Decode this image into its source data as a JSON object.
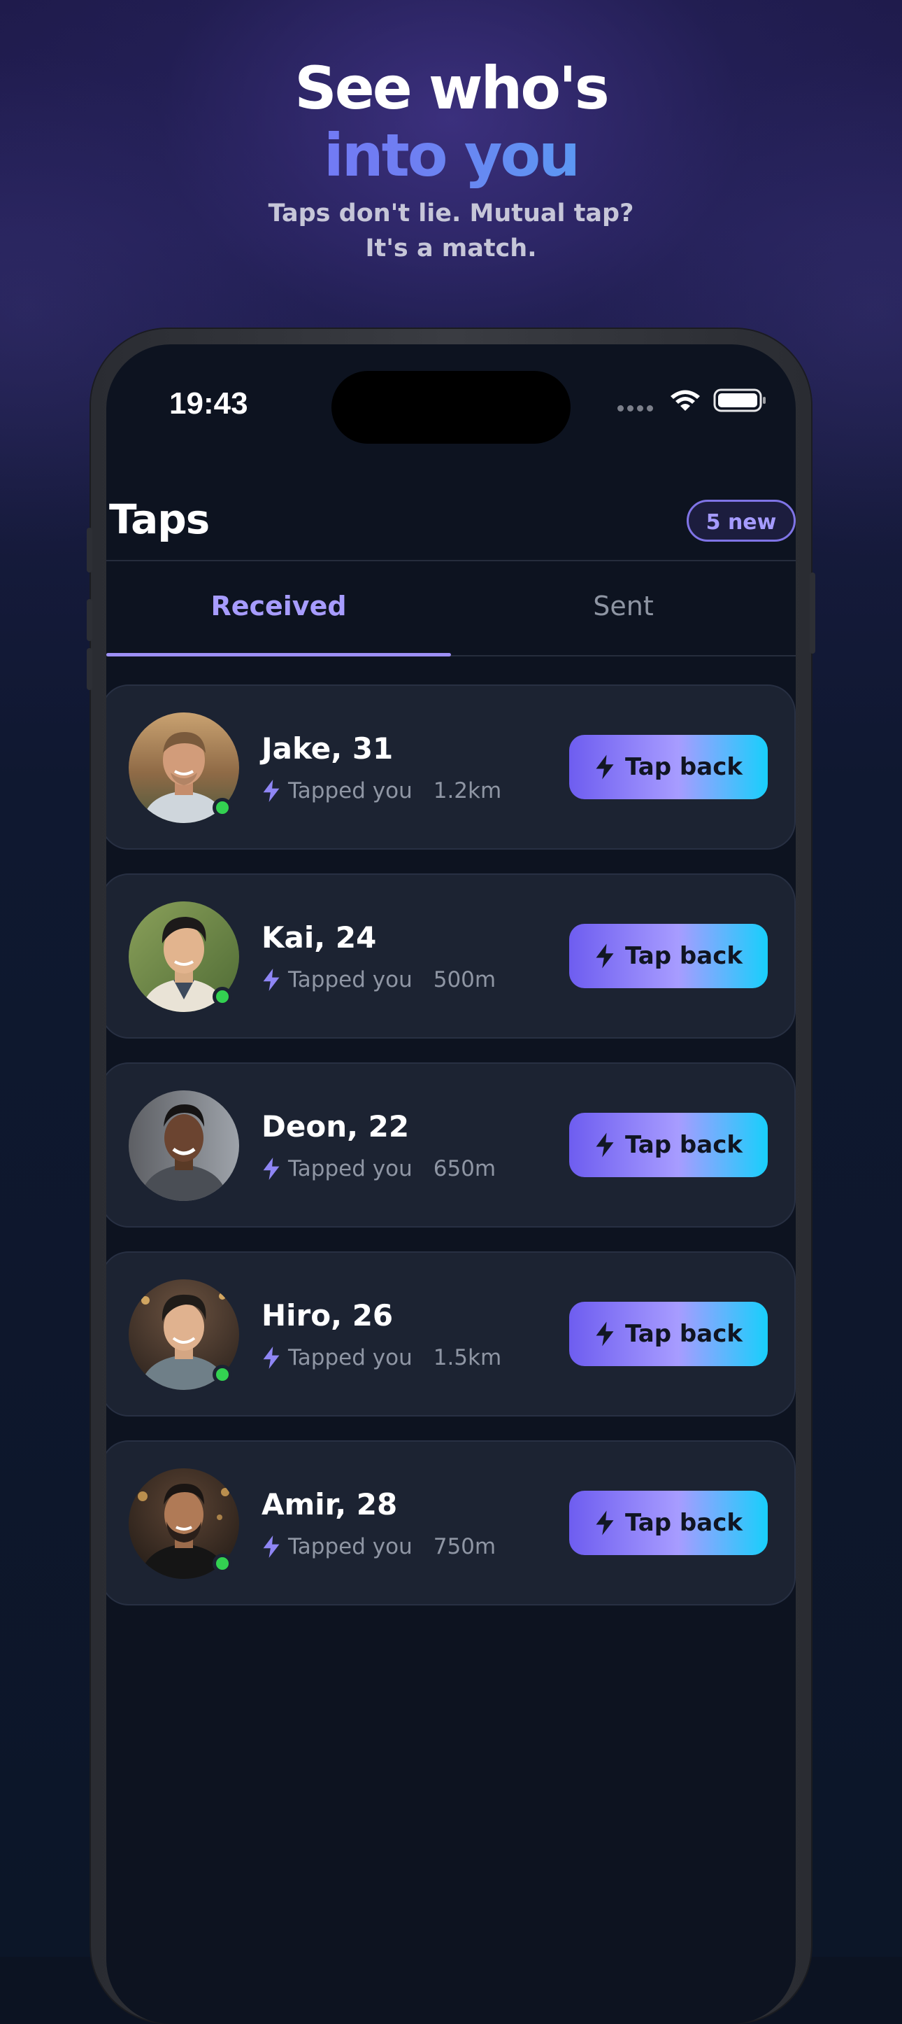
{
  "hero": {
    "line1": "See who's",
    "line2": "into you",
    "subtitle_line1": "Taps don't lie. Mutual tap?",
    "subtitle_line2": "It's a match."
  },
  "status_bar": {
    "time": "19:43"
  },
  "header": {
    "title": "Taps",
    "badge": "5 new"
  },
  "tabs": {
    "received": "Received",
    "sent": "Sent",
    "active": "Received"
  },
  "taps": [
    {
      "name": "Jake, 31",
      "status": "Tapped you",
      "distance": "1.2km",
      "online": true,
      "button": "Tap back"
    },
    {
      "name": "Kai, 24",
      "status": "Tapped you",
      "distance": "500m",
      "online": true,
      "button": "Tap back"
    },
    {
      "name": "Deon, 22",
      "status": "Tapped you",
      "distance": "650m",
      "online": false,
      "button": "Tap back"
    },
    {
      "name": "Hiro, 26",
      "status": "Tapped you",
      "distance": "1.5km",
      "online": true,
      "button": "Tap back"
    },
    {
      "name": "Amir, 28",
      "status": "Tapped you",
      "distance": "750m",
      "online": true,
      "button": "Tap back"
    }
  ],
  "colors": {
    "accent": "#a79cff",
    "button_gradient_start": "#6e5df0",
    "button_gradient_end": "#18cffb",
    "online": "#33d151",
    "card": "#1c2332",
    "screen": "#0d1320"
  }
}
